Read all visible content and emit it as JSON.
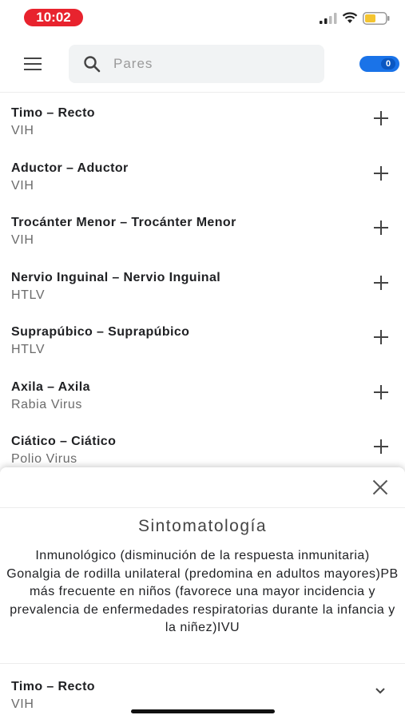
{
  "status_bar": {
    "time": "10:02",
    "time_color": "#e8232e",
    "signal_icon": "cellular-signal-icon",
    "wifi_icon": "wifi-icon",
    "battery_icon": "battery-icon",
    "battery_color": "#f4c430"
  },
  "top_bar": {
    "menu_icon": "hamburger-menu-icon",
    "search": {
      "placeholder": "Pares",
      "value": "",
      "icon": "search-icon"
    },
    "toggle": {
      "count": "0",
      "color": "#1a73e8"
    }
  },
  "list": {
    "items": [
      {
        "title": "Timo – Recto",
        "subtitle": "VIH"
      },
      {
        "title": "Aductor – Aductor",
        "subtitle": "VIH"
      },
      {
        "title": "Trocánter Menor – Trocánter Menor",
        "subtitle": "VIH"
      },
      {
        "title": "Nervio Inguinal – Nervio Inguinal",
        "subtitle": "HTLV"
      },
      {
        "title": "Suprapúbico – Suprapúbico",
        "subtitle": "HTLV"
      },
      {
        "title": "Axila – Axila",
        "subtitle": "Rabia Virus"
      },
      {
        "title": "Ciático – Ciático",
        "subtitle": "Polio Virus"
      }
    ],
    "add_icon": "plus-icon"
  },
  "sheet": {
    "close_icon": "close-icon",
    "title": "Sintomatología",
    "body": "Inmunológico (disminución de la respuesta inmunitaria) Gonalgia de rodilla unilateral (predomina en adultos mayores)PB más frecuente en niños (favorece una mayor incidencia y prevalencia de enfermedades respiratorias durante la infancia y la niñez)IVU",
    "selected": {
      "title": "Timo – Recto",
      "subtitle": "VIH"
    },
    "expand_icon": "chevron-down-icon"
  }
}
